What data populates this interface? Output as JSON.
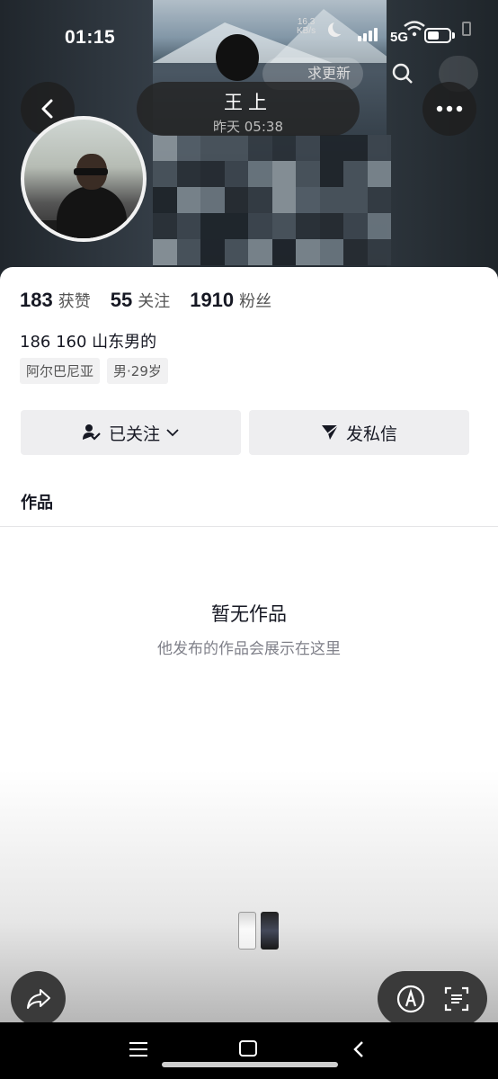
{
  "status_bar": {
    "time": "01:15",
    "speed_value": "16.3",
    "speed_unit": "KB/s",
    "network": "5G"
  },
  "header": {
    "name": "王上",
    "subtitle": "昨天 05:38",
    "update_request": "求更新"
  },
  "profile": {
    "stats": [
      {
        "value": "183",
        "label": "获赞"
      },
      {
        "value": "55",
        "label": "关注"
      },
      {
        "value": "1910",
        "label": "粉丝"
      }
    ],
    "bio": "186 160 山东男的",
    "tags": [
      "阿尔巴尼亚",
      "男·29岁"
    ]
  },
  "actions": {
    "follow": "已关注",
    "message": "发私信"
  },
  "tabs": {
    "works": "作品"
  },
  "empty_state": {
    "title": "暂无作品",
    "subtitle": "他发布的作品会展示在这里"
  },
  "colors": {
    "text_primary": "#161823",
    "button_bg": "#eeeef0",
    "overlay_bg": "#3a3a3a"
  }
}
